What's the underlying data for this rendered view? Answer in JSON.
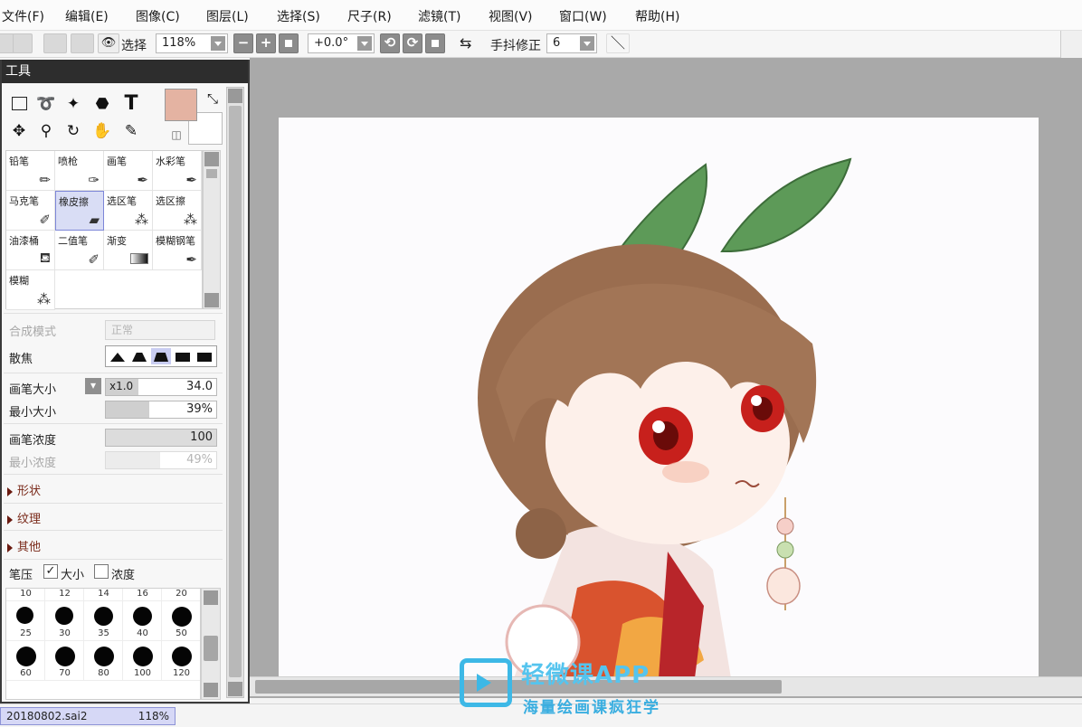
{
  "menu": [
    "文件(F)",
    "编辑(E)",
    "图像(C)",
    "图层(L)",
    "选择(S)",
    "尺子(R)",
    "滤镜(T)",
    "视图(V)",
    "窗口(W)",
    "帮助(H)"
  ],
  "toolbar": {
    "select_label": "选择",
    "zoom_value": "118%",
    "minus": "−",
    "plus": "+",
    "rotation_value": "+0.0°",
    "stabilizer_label": "手抖修正",
    "stabilizer_value": "6"
  },
  "tool_panel": {
    "title": "工具",
    "tools": [
      "rect-select",
      "lasso",
      "magic-wand",
      "select-pen",
      "text",
      "move",
      "zoom",
      "rotate",
      "hand",
      "eyedropper"
    ],
    "brushes": [
      {
        "name": "铅笔",
        "icon": "pencil-icon"
      },
      {
        "name": "喷枪",
        "icon": "airbrush-icon"
      },
      {
        "name": "画笔",
        "icon": "brush-icon"
      },
      {
        "name": "水彩笔",
        "icon": "watercolor-icon"
      },
      {
        "name": "马克笔",
        "icon": "marker-icon"
      },
      {
        "name": "橡皮擦",
        "icon": "eraser-icon",
        "selected": true
      },
      {
        "name": "选区笔",
        "icon": "select-brush-icon"
      },
      {
        "name": "选区擦",
        "icon": "select-eraser-icon"
      },
      {
        "name": "油漆桶",
        "icon": "bucket-icon"
      },
      {
        "name": "二值笔",
        "icon": "binary-pen-icon"
      },
      {
        "name": "渐变",
        "icon": "gradient-icon"
      },
      {
        "name": "模糊钢笔",
        "icon": "blur-pen-icon"
      },
      {
        "name": "模糊",
        "icon": "blur-icon"
      }
    ],
    "blend_mode_label": "合成模式",
    "blend_mode_value": "正常",
    "edge_label": "散焦",
    "brush_size_label": "画笔大小",
    "brush_size_multiplier": "x1.0",
    "brush_size_value": "34.0",
    "min_size_label": "最小大小",
    "min_size_value": "39%",
    "min_size_fraction": 0.39,
    "density_label": "画笔浓度",
    "density_value": "100",
    "min_density_label": "最小浓度",
    "min_density_value": "49%",
    "min_density_fraction": 0.49,
    "sections": [
      "形状",
      "纹理",
      "其他"
    ],
    "pressure_label": "笔压",
    "pressure_size_label": "大小",
    "pressure_size_checked": "✓",
    "pressure_density_label": "浓度",
    "size_presets": [
      "10",
      "12",
      "14",
      "16",
      "20",
      "25",
      "30",
      "35",
      "40",
      "50",
      "60",
      "70",
      "80",
      "100",
      "120"
    ]
  },
  "colors": {
    "foreground": "#e4b3a2",
    "background": "#ffffff"
  },
  "status": {
    "file_name": "20180802.sai2",
    "zoom": "118%"
  },
  "watermark": {
    "line1": "轻微课APP",
    "line2": "海量绘画课疯狂学"
  }
}
